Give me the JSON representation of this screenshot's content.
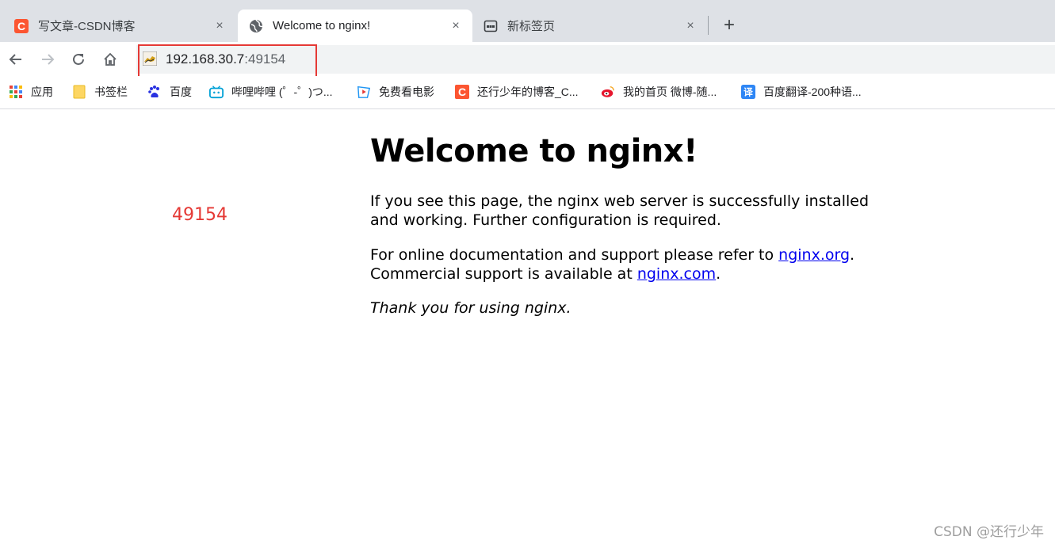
{
  "tabs": [
    {
      "title": "写文章-CSDN博客",
      "icon": "csdn-logo-icon",
      "close": "×"
    },
    {
      "title": "Welcome to nginx!",
      "icon": "globe-icon",
      "close": "×"
    },
    {
      "title": "新标签页",
      "icon": "new-tab-page-icon",
      "close": "×"
    }
  ],
  "new_tab_symbol": "+",
  "address_bar": {
    "host": "192.168.30.7",
    "port": ":49154",
    "site_icon": "tomcat-icon"
  },
  "bookmarks": [
    {
      "label": "应用",
      "icon": "apps-grid-icon"
    },
    {
      "label": "书签栏",
      "icon": "folder-icon"
    },
    {
      "label": "百度",
      "icon": "baidu-paw-icon"
    },
    {
      "label": "哔哩哔哩 (゜-゜)つ...",
      "icon": "bilibili-icon"
    },
    {
      "label": "免费看电影",
      "icon": "video-play-icon"
    },
    {
      "label": "还行少年的博客_C...",
      "icon": "csdn-logo-icon"
    },
    {
      "label": "我的首页 微博-随...",
      "icon": "weibo-icon"
    },
    {
      "label": "百度翻译-200种语...",
      "icon": "translate-icon"
    }
  ],
  "page": {
    "heading": "Welcome to nginx!",
    "para1": "If you see this page, the nginx web server is successfully installed and working. Further configuration is required.",
    "para2_prefix": "For online documentation and support please refer to ",
    "link1": "nginx.org",
    "para2_mid": ".",
    "para2_line2": "Commercial support is available at ",
    "link2": "nginx.com",
    "para2_end": ".",
    "thanks": "Thank you for using nginx."
  },
  "annotation": "49154",
  "watermark": "CSDN @还行少年",
  "colors": {
    "highlight_box": "#e53935",
    "csdn_red": "#fc5531",
    "link": "#0000ee"
  }
}
